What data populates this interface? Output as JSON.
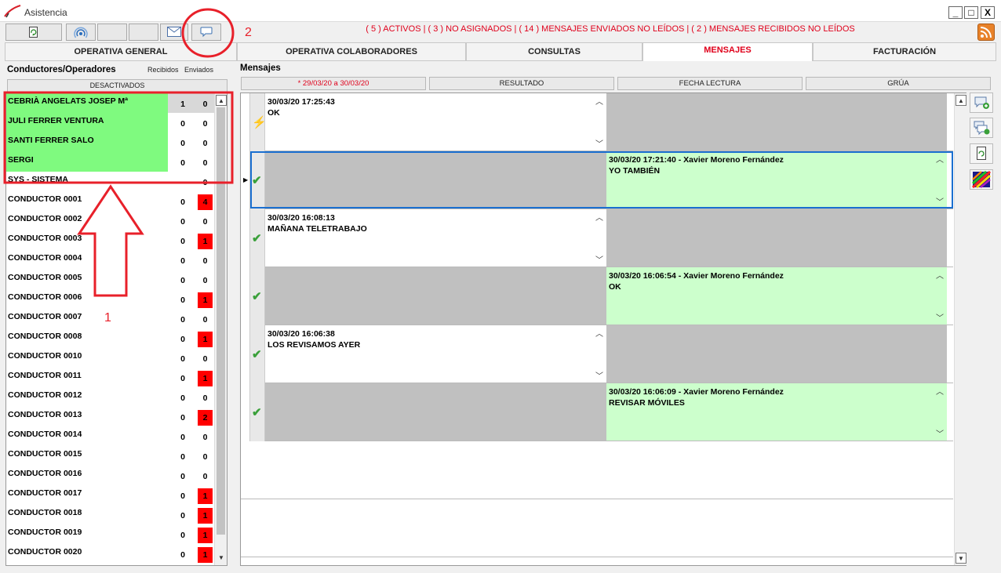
{
  "window": {
    "title": "Asistencia",
    "minimize": "_",
    "maximize": "□",
    "close": "X"
  },
  "toolbar": {
    "status": "( 5 ) ACTIVOS | ( 3 ) NO ASIGNADOS | ( 14 ) MENSAJES ENVIADOS NO LEÍDOS | ( 2 ) MENSAJES RECIBIDOS NO LEÍDOS",
    "buttons": [
      "refresh-icon",
      "antenna-icon",
      "blank",
      "blank",
      "envelope-icon",
      "chat-bubble-icon"
    ],
    "feed_icon": "rss-icon"
  },
  "tabs": [
    {
      "label": "OPERATIVA GENERAL",
      "active": false
    },
    {
      "label": "OPERATIVA COLABORADORES",
      "active": false
    },
    {
      "label": "CONSULTAS",
      "active": false
    },
    {
      "label": "MENSAJES",
      "active": true
    },
    {
      "label": "FACTURACIÓN",
      "active": false
    }
  ],
  "left_panel": {
    "title": "Conductores/Operadores",
    "received_label": "Recibidos",
    "sent_label": "Enviados",
    "deactivated_button": "DESACTIVADOS",
    "drivers": [
      {
        "name": "CEBRIÀ ANGELATS JOSEP Mª",
        "received": "1",
        "sent": "0",
        "active": true,
        "sent_alert": false,
        "selected": true
      },
      {
        "name": "JULI FERRER VENTURA",
        "received": "0",
        "sent": "0",
        "active": true,
        "sent_alert": false
      },
      {
        "name": "SANTI FERRER SALO",
        "received": "0",
        "sent": "0",
        "active": true,
        "sent_alert": false
      },
      {
        "name": "SERGI",
        "received": "0",
        "sent": "0",
        "active": true,
        "sent_alert": false
      },
      {
        "name": "SYS - SISTEMA",
        "received": "",
        "sent": "0",
        "active": false,
        "sent_alert": false
      },
      {
        "name": "CONDUCTOR 0001",
        "received": "0",
        "sent": "4",
        "active": false,
        "sent_alert": true
      },
      {
        "name": "CONDUCTOR 0002",
        "received": "0",
        "sent": "0",
        "active": false,
        "sent_alert": false
      },
      {
        "name": "CONDUCTOR 0003",
        "received": "0",
        "sent": "1",
        "active": false,
        "sent_alert": true
      },
      {
        "name": "CONDUCTOR 0004",
        "received": "0",
        "sent": "0",
        "active": false,
        "sent_alert": false
      },
      {
        "name": "CONDUCTOR 0005",
        "received": "0",
        "sent": "0",
        "active": false,
        "sent_alert": false
      },
      {
        "name": "CONDUCTOR 0006",
        "received": "0",
        "sent": "1",
        "active": false,
        "sent_alert": true
      },
      {
        "name": "CONDUCTOR 0007",
        "received": "0",
        "sent": "0",
        "active": false,
        "sent_alert": false
      },
      {
        "name": "CONDUCTOR 0008",
        "received": "0",
        "sent": "1",
        "active": false,
        "sent_alert": true
      },
      {
        "name": "CONDUCTOR 0010",
        "received": "0",
        "sent": "0",
        "active": false,
        "sent_alert": false
      },
      {
        "name": "CONDUCTOR 0011",
        "received": "0",
        "sent": "1",
        "active": false,
        "sent_alert": true
      },
      {
        "name": "CONDUCTOR 0012",
        "received": "0",
        "sent": "0",
        "active": false,
        "sent_alert": false
      },
      {
        "name": "CONDUCTOR 0013",
        "received": "0",
        "sent": "2",
        "active": false,
        "sent_alert": true
      },
      {
        "name": "CONDUCTOR 0014",
        "received": "0",
        "sent": "0",
        "active": false,
        "sent_alert": false
      },
      {
        "name": "CONDUCTOR 0015",
        "received": "0",
        "sent": "0",
        "active": false,
        "sent_alert": false
      },
      {
        "name": "CONDUCTOR 0016",
        "received": "0",
        "sent": "0",
        "active": false,
        "sent_alert": false
      },
      {
        "name": "CONDUCTOR 0017",
        "received": "0",
        "sent": "1",
        "active": false,
        "sent_alert": true
      },
      {
        "name": "CONDUCTOR 0018",
        "received": "0",
        "sent": "1",
        "active": false,
        "sent_alert": true
      },
      {
        "name": "CONDUCTOR 0019",
        "received": "0",
        "sent": "1",
        "active": false,
        "sent_alert": true
      },
      {
        "name": "CONDUCTOR 0020",
        "received": "0",
        "sent": "1",
        "active": false,
        "sent_alert": true
      }
    ]
  },
  "messages_panel": {
    "title": "Mensajes",
    "columns": [
      "* 29/03/20 a 30/03/20",
      "RESULTADO",
      "FECHA LECTURA",
      "GRÚA"
    ],
    "rows": [
      {
        "icon": "lightning-icon",
        "side": "left",
        "header": "30/03/20 17:25:43",
        "body": "OK",
        "selected": false
      },
      {
        "icon": "check-icon",
        "side": "right",
        "header": "30/03/20 17:21:40 - Xavier Moreno Fernández",
        "body": "YO TAMBIÉN",
        "selected": true
      },
      {
        "icon": "check-icon",
        "side": "left",
        "header": "30/03/20 16:08:13",
        "body": "MAÑANA TELETRABAJO",
        "selected": false
      },
      {
        "icon": "check-icon",
        "side": "right",
        "header": "30/03/20 16:06:54 - Xavier Moreno Fernández",
        "body": "OK",
        "selected": false
      },
      {
        "icon": "check-icon",
        "side": "left",
        "header": "30/03/20 16:06:38",
        "body": "LOS REVISAMOS AYER",
        "selected": false
      },
      {
        "icon": "check-icon",
        "side": "right",
        "header": "30/03/20 16:06:09 - Xavier Moreno Fernández",
        "body": "REVISAR MÓVILES",
        "selected": false
      }
    ]
  },
  "side_buttons": [
    "new-message-icon",
    "reply-message-icon",
    "refresh-icon",
    "color-palette-icon"
  ],
  "annotations": {
    "label_1": "1",
    "label_2": "2",
    "color": "#e8202a"
  }
}
